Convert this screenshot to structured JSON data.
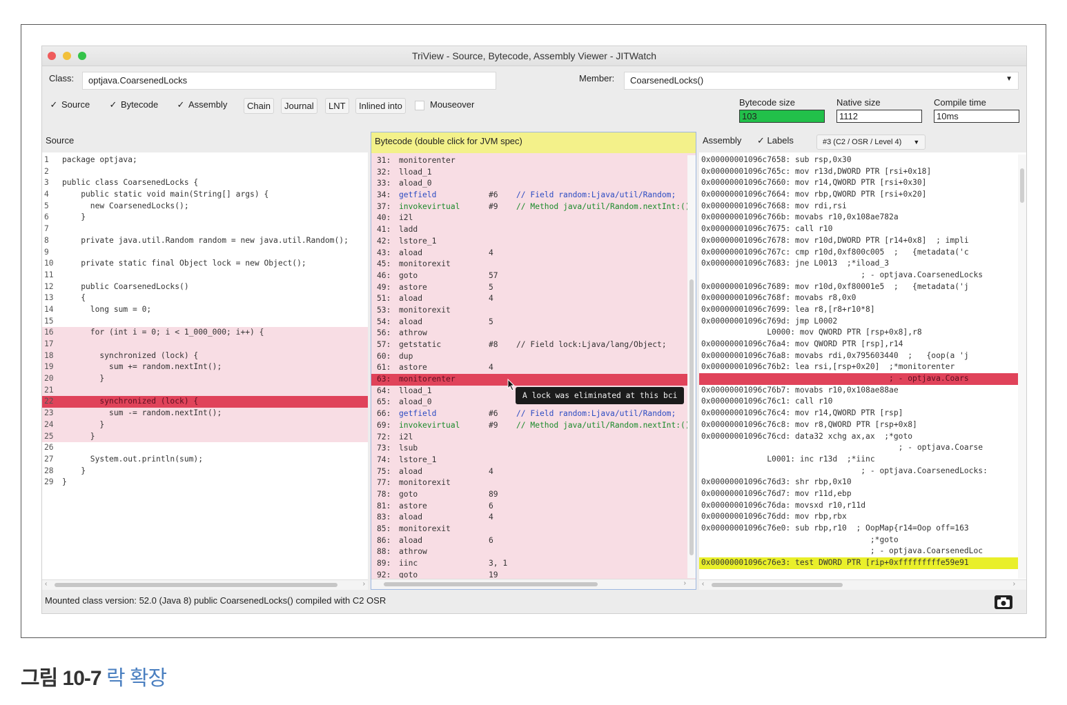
{
  "window": {
    "title": "TriView - Source, Bytecode, Assembly Viewer - JITWatch"
  },
  "toolbar": {
    "class_label": "Class:",
    "class_value": "optjava.CoarsenedLocks",
    "member_label": "Member:",
    "member_value": "CoarsenedLocks()",
    "checks": [
      {
        "label": "Source",
        "checked": true
      },
      {
        "label": "Bytecode",
        "checked": true
      },
      {
        "label": "Assembly",
        "checked": true
      }
    ],
    "buttons": [
      "Chain",
      "Journal",
      "LNT",
      "Inlined into"
    ],
    "mouseover_label": "Mouseover",
    "mouseover_checked": false,
    "stats": {
      "bytecode_size_label": "Bytecode size",
      "bytecode_size_value": "103",
      "native_size_label": "Native size",
      "native_size_value": "1112",
      "compile_time_label": "Compile time",
      "compile_time_value": "10ms"
    }
  },
  "source": {
    "header": "Source",
    "lines": [
      {
        "no": "1",
        "text": "package optjava;",
        "hl": ""
      },
      {
        "no": "2",
        "text": "",
        "hl": ""
      },
      {
        "no": "3",
        "text": "public class CoarsenedLocks {",
        "hl": ""
      },
      {
        "no": "4",
        "text": "    public static void main(String[] args) {",
        "hl": ""
      },
      {
        "no": "5",
        "text": "      new CoarsenedLocks();",
        "hl": ""
      },
      {
        "no": "6",
        "text": "    }",
        "hl": ""
      },
      {
        "no": "7",
        "text": "",
        "hl": ""
      },
      {
        "no": "8",
        "text": "    private java.util.Random random = new java.util.Random();",
        "hl": ""
      },
      {
        "no": "9",
        "text": "",
        "hl": ""
      },
      {
        "no": "10",
        "text": "    private static final Object lock = new Object();",
        "hl": ""
      },
      {
        "no": "11",
        "text": "",
        "hl": ""
      },
      {
        "no": "12",
        "text": "    public CoarsenedLocks()",
        "hl": ""
      },
      {
        "no": "13",
        "text": "    {",
        "hl": ""
      },
      {
        "no": "14",
        "text": "      long sum = 0;",
        "hl": ""
      },
      {
        "no": "15",
        "text": "",
        "hl": ""
      },
      {
        "no": "16",
        "text": "      for (int i = 0; i < 1_000_000; i++) {",
        "hl": "pink"
      },
      {
        "no": "17",
        "text": "",
        "hl": "pink"
      },
      {
        "no": "18",
        "text": "        synchronized (lock) {",
        "hl": "pink"
      },
      {
        "no": "19",
        "text": "          sum += random.nextInt();",
        "hl": "pink"
      },
      {
        "no": "20",
        "text": "        }",
        "hl": "pink"
      },
      {
        "no": "21",
        "text": "",
        "hl": "pink"
      },
      {
        "no": "22",
        "text": "        synchronized (lock) {",
        "hl": "red"
      },
      {
        "no": "23",
        "text": "          sum -= random.nextInt();",
        "hl": "pink"
      },
      {
        "no": "24",
        "text": "        }",
        "hl": "pink"
      },
      {
        "no": "25",
        "text": "      }",
        "hl": "pink"
      },
      {
        "no": "26",
        "text": "",
        "hl": ""
      },
      {
        "no": "27",
        "text": "      System.out.println(sum);",
        "hl": ""
      },
      {
        "no": "28",
        "text": "    }",
        "hl": ""
      },
      {
        "no": "29",
        "text": "}",
        "hl": ""
      }
    ]
  },
  "bytecode": {
    "header": "Bytecode (double click for JVM spec)",
    "lines": [
      {
        "off": "31:",
        "op": "monitorenter",
        "arg": "",
        "cmt": "",
        "hl": ""
      },
      {
        "off": "32:",
        "op": "lload_1",
        "arg": "",
        "cmt": "",
        "hl": ""
      },
      {
        "off": "33:",
        "op": "aload_0",
        "arg": "",
        "cmt": "",
        "hl": ""
      },
      {
        "off": "34:",
        "op": "getfield",
        "arg": "#6",
        "cmt": "// Field random:Ljava/util/Random;",
        "hl": "",
        "opcolor": "blue"
      },
      {
        "off": "37:",
        "op": "invokevirtual",
        "arg": "#9",
        "cmt": "// Method java/util/Random.nextInt:()I",
        "hl": "",
        "opcolor": "green"
      },
      {
        "off": "40:",
        "op": "i2l",
        "arg": "",
        "cmt": "",
        "hl": ""
      },
      {
        "off": "41:",
        "op": "ladd",
        "arg": "",
        "cmt": "",
        "hl": ""
      },
      {
        "off": "42:",
        "op": "lstore_1",
        "arg": "",
        "cmt": "",
        "hl": ""
      },
      {
        "off": "43:",
        "op": "aload",
        "arg": "4",
        "cmt": "",
        "hl": ""
      },
      {
        "off": "45:",
        "op": "monitorexit",
        "arg": "",
        "cmt": "",
        "hl": ""
      },
      {
        "off": "46:",
        "op": "goto",
        "arg": "57",
        "cmt": "",
        "hl": ""
      },
      {
        "off": "49:",
        "op": "astore",
        "arg": "5",
        "cmt": "",
        "hl": ""
      },
      {
        "off": "51:",
        "op": "aload",
        "arg": "4",
        "cmt": "",
        "hl": ""
      },
      {
        "off": "53:",
        "op": "monitorexit",
        "arg": "",
        "cmt": "",
        "hl": ""
      },
      {
        "off": "54:",
        "op": "aload",
        "arg": "5",
        "cmt": "",
        "hl": ""
      },
      {
        "off": "56:",
        "op": "athrow",
        "arg": "",
        "cmt": "",
        "hl": ""
      },
      {
        "off": "57:",
        "op": "getstatic",
        "arg": "#8",
        "cmt": "// Field lock:Ljava/lang/Object;",
        "hl": ""
      },
      {
        "off": "60:",
        "op": "dup",
        "arg": "",
        "cmt": "",
        "hl": ""
      },
      {
        "off": "61:",
        "op": "astore",
        "arg": "4",
        "cmt": "",
        "hl": ""
      },
      {
        "off": "63:",
        "op": "monitorenter",
        "arg": "",
        "cmt": "",
        "hl": "red"
      },
      {
        "off": "64:",
        "op": "lload_1",
        "arg": "",
        "cmt": "",
        "hl": ""
      },
      {
        "off": "65:",
        "op": "aload_0",
        "arg": "",
        "cmt": "",
        "hl": ""
      },
      {
        "off": "66:",
        "op": "getfield",
        "arg": "#6",
        "cmt": "// Field random:Ljava/util/Random;",
        "hl": "",
        "opcolor": "blue"
      },
      {
        "off": "69:",
        "op": "invokevirtual",
        "arg": "#9",
        "cmt": "// Method java/util/Random.nextInt:()I",
        "hl": "",
        "opcolor": "green"
      },
      {
        "off": "72:",
        "op": "i2l",
        "arg": "",
        "cmt": "",
        "hl": ""
      },
      {
        "off": "73:",
        "op": "lsub",
        "arg": "",
        "cmt": "",
        "hl": ""
      },
      {
        "off": "74:",
        "op": "lstore_1",
        "arg": "",
        "cmt": "",
        "hl": ""
      },
      {
        "off": "75:",
        "op": "aload",
        "arg": "4",
        "cmt": "",
        "hl": ""
      },
      {
        "off": "77:",
        "op": "monitorexit",
        "arg": "",
        "cmt": "",
        "hl": ""
      },
      {
        "off": "78:",
        "op": "goto",
        "arg": "89",
        "cmt": "",
        "hl": ""
      },
      {
        "off": "81:",
        "op": "astore",
        "arg": "6",
        "cmt": "",
        "hl": ""
      },
      {
        "off": "83:",
        "op": "aload",
        "arg": "4",
        "cmt": "",
        "hl": ""
      },
      {
        "off": "85:",
        "op": "monitorexit",
        "arg": "",
        "cmt": "",
        "hl": ""
      },
      {
        "off": "86:",
        "op": "aload",
        "arg": "6",
        "cmt": "",
        "hl": ""
      },
      {
        "off": "88:",
        "op": "athrow",
        "arg": "",
        "cmt": "",
        "hl": ""
      },
      {
        "off": "89:",
        "op": "iinc",
        "arg": "3, 1",
        "cmt": "",
        "hl": ""
      },
      {
        "off": "92:",
        "op": "goto",
        "arg": "19",
        "cmt": "",
        "hl": ""
      }
    ],
    "tooltip": "A lock was eliminated at this bci"
  },
  "assembly": {
    "header": "Assembly",
    "labels_label": "Labels",
    "labels_checked": true,
    "compilation": "#3 (C2 / OSR / Level 4)",
    "lines": [
      {
        "text": "0x00000001096c7658: sub rsp,0x30",
        "hl": ""
      },
      {
        "text": "0x00000001096c765c: mov r13d,DWORD PTR [rsi+0x18]",
        "hl": ""
      },
      {
        "text": "0x00000001096c7660: mov r14,QWORD PTR [rsi+0x30]",
        "hl": ""
      },
      {
        "text": "0x00000001096c7664: mov rbp,QWORD PTR [rsi+0x20]",
        "hl": ""
      },
      {
        "text": "0x00000001096c7668: mov rdi,rsi",
        "hl": ""
      },
      {
        "text": "0x00000001096c766b: movabs r10,0x108ae782a",
        "hl": ""
      },
      {
        "text": "0x00000001096c7675: call r10",
        "hl": ""
      },
      {
        "text": "0x00000001096c7678: mov r10d,DWORD PTR [r14+0x8]  ; impli",
        "hl": ""
      },
      {
        "text": "0x00000001096c767c: cmp r10d,0xf800c005  ;   {metadata('c",
        "hl": ""
      },
      {
        "text": "0x00000001096c7683: jne L0013  ;*iload_3",
        "hl": ""
      },
      {
        "text": "                                  ; - optjava.CoarsenedLocks",
        "hl": ""
      },
      {
        "text": "0x00000001096c7689: mov r10d,0xf80001e5  ;   {metadata('j",
        "hl": ""
      },
      {
        "text": "0x00000001096c768f: movabs r8,0x0",
        "hl": ""
      },
      {
        "text": "0x00000001096c7699: lea r8,[r8+r10*8]",
        "hl": ""
      },
      {
        "text": "0x00000001096c769d: jmp L0002",
        "hl": ""
      },
      {
        "text": "              L0000: mov QWORD PTR [rsp+0x8],r8",
        "hl": ""
      },
      {
        "text": "0x00000001096c76a4: mov QWORD PTR [rsp],r14",
        "hl": ""
      },
      {
        "text": "0x00000001096c76a8: movabs rdi,0x795603440  ;   {oop(a 'j",
        "hl": ""
      },
      {
        "text": "0x00000001096c76b2: lea rsi,[rsp+0x20]  ;*monitorenter",
        "hl": ""
      },
      {
        "text": "                                        ; - optjava.Coars",
        "hl": "red"
      },
      {
        "text": "0x00000001096c76b7: movabs r10,0x108ae88ae",
        "hl": ""
      },
      {
        "text": "0x00000001096c76c1: call r10",
        "hl": ""
      },
      {
        "text": "0x00000001096c76c4: mov r14,QWORD PTR [rsp]",
        "hl": ""
      },
      {
        "text": "0x00000001096c76c8: mov r8,QWORD PTR [rsp+0x8]",
        "hl": ""
      },
      {
        "text": "0x00000001096c76cd: data32 xchg ax,ax  ;*goto",
        "hl": ""
      },
      {
        "text": "                                          ; - optjava.Coarse",
        "hl": ""
      },
      {
        "text": "              L0001: inc r13d  ;*iinc",
        "hl": ""
      },
      {
        "text": "                                  ; - optjava.CoarsenedLocks:",
        "hl": ""
      },
      {
        "text": "0x00000001096c76d3: shr rbp,0x10",
        "hl": ""
      },
      {
        "text": "0x00000001096c76d7: mov r11d,ebp",
        "hl": ""
      },
      {
        "text": "0x00000001096c76da: movsxd r10,r11d",
        "hl": ""
      },
      {
        "text": "0x00000001096c76dd: mov rbp,rbx",
        "hl": ""
      },
      {
        "text": "0x00000001096c76e0: sub rbp,r10  ; OopMap{r14=Oop off=163",
        "hl": ""
      },
      {
        "text": "                                    ;*goto",
        "hl": ""
      },
      {
        "text": "                                    ; - optjava.CoarsenedLoc",
        "hl": ""
      },
      {
        "text": "0x00000001096c76e3: test DWORD PTR [rip+0xfffffffffe59e91",
        "hl": "yellow"
      }
    ]
  },
  "status": {
    "text": "Mounted class version: 52.0 (Java 8) public CoarsenedLocks() compiled with C2 OSR"
  },
  "caption": {
    "figure": "그림 10-7",
    "subtitle": "락 확장"
  },
  "colors": {
    "pink": "#f8dde4",
    "red": "#e0435a",
    "yellow": "#e9ef2a",
    "bytecode_header": "#f3f18a",
    "green_bar": "#22c04a",
    "op_blue": "#2b4bc2",
    "op_green": "#1a8a2a"
  }
}
